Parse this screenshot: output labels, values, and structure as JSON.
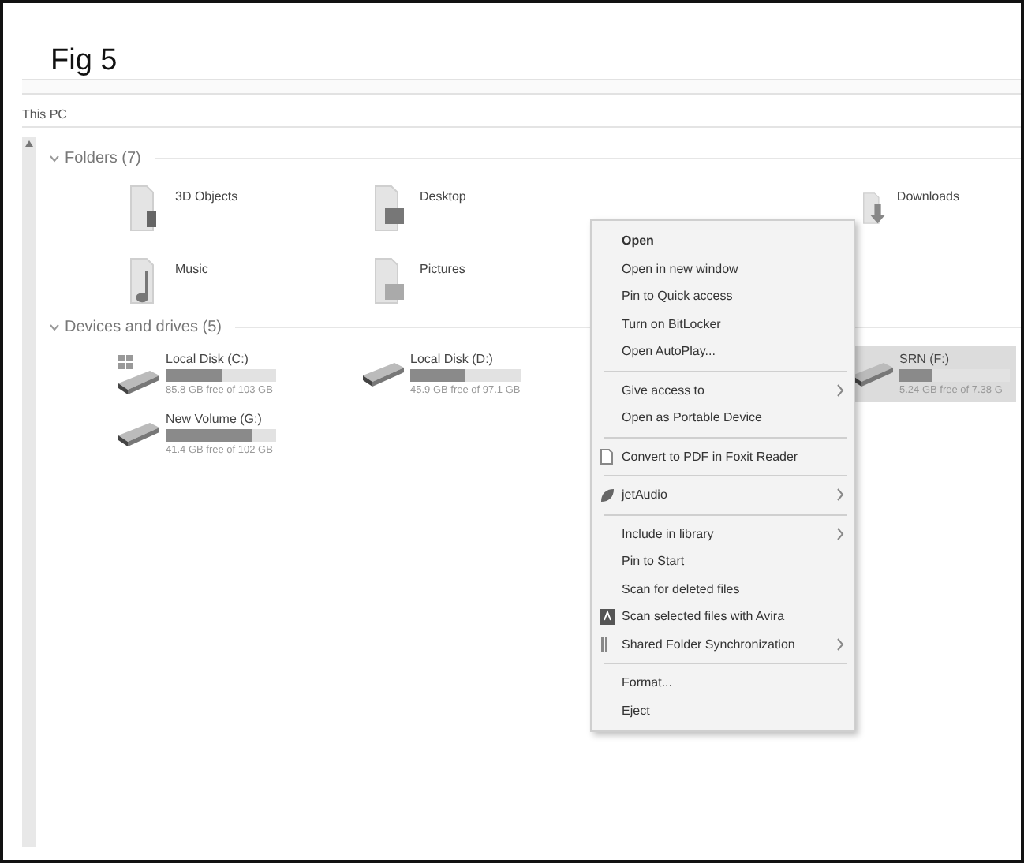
{
  "caption": "Fig 5",
  "address": "This PC",
  "folders_group": {
    "title": "Folders (7)",
    "expanded": true
  },
  "folders": [
    {
      "name": "3D Objects",
      "kind": "objects"
    },
    {
      "name": "Desktop",
      "kind": "desktop"
    },
    {
      "name": "Downloads",
      "kind": "downloads"
    },
    {
      "name": "Music",
      "kind": "music"
    },
    {
      "name": "Pictures",
      "kind": "pictures"
    }
  ],
  "drives_group": {
    "title": "Devices and drives (5)",
    "expanded": true
  },
  "drives": [
    {
      "kind": "system",
      "name": "Local Disk (C:)",
      "free": "85.8 GB free of 103 GB",
      "level": 0.52,
      "selected": false
    },
    {
      "kind": "disk",
      "name": "Local Disk (D:)",
      "free": "45.9 GB free of 97.1 GB",
      "level": 0.5,
      "selected": false
    },
    {
      "kind": "disk",
      "name": "SRN (F:)",
      "free": "5.24 GB free of 7.38 G",
      "level": 0.3,
      "selected": true
    },
    {
      "kind": "disk",
      "name": "New Volume (G:)",
      "free": "41.4 GB free of 102 GB",
      "level": 0.78,
      "selected": false
    }
  ],
  "context_menu": [
    {
      "kind": "item",
      "label": "Open",
      "default": true
    },
    {
      "kind": "item",
      "label": "Open in new window"
    },
    {
      "kind": "item",
      "label": "Pin to Quick access"
    },
    {
      "kind": "item",
      "label": "Turn on BitLocker"
    },
    {
      "kind": "item",
      "label": "Open AutoPlay..."
    },
    {
      "kind": "separator"
    },
    {
      "kind": "item",
      "label": "Give access to",
      "submenu": true
    },
    {
      "kind": "item",
      "label": "Open as Portable Device"
    },
    {
      "kind": "separator"
    },
    {
      "kind": "pdf",
      "label": "Convert to PDF in Foxit Reader"
    },
    {
      "kind": "separator"
    },
    {
      "kind": "audio",
      "label": "jetAudio",
      "submenu": true
    },
    {
      "kind": "separator"
    },
    {
      "kind": "item",
      "label": "Include in library",
      "submenu": true
    },
    {
      "kind": "item",
      "label": "Pin to Start"
    },
    {
      "kind": "item",
      "label": "Scan for deleted files"
    },
    {
      "kind": "antivirus",
      "label": "Scan selected files with Avira"
    },
    {
      "kind": "sync",
      "label": "Shared Folder Synchronization",
      "submenu": true
    },
    {
      "kind": "separator"
    },
    {
      "kind": "item",
      "label": "Format..."
    },
    {
      "kind": "item",
      "label": "Eject"
    }
  ]
}
